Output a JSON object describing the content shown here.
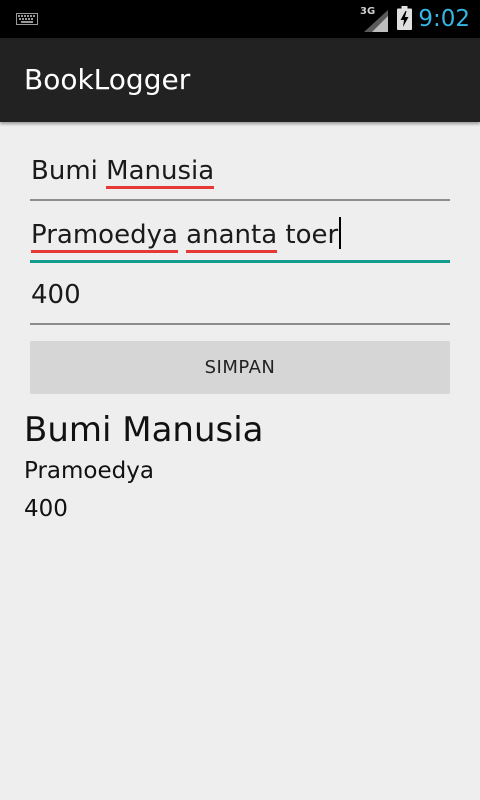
{
  "status_bar": {
    "time": "9:02",
    "network": "3G",
    "icons": [
      "keyboard-icon",
      "signal-icon",
      "battery-charging-icon"
    ]
  },
  "app": {
    "title": "BookLogger"
  },
  "form": {
    "title_value": [
      "Bumi ",
      "Manusia"
    ],
    "author_value": [
      "Pramoedya",
      " ",
      "ananta",
      " toer"
    ],
    "pages_value": "400",
    "save_label": "SIMPAN"
  },
  "result": {
    "title": "Bumi Manusia",
    "author": "Pramoedya",
    "pages": "400"
  },
  "colors": {
    "status_bar_bg": "#000000",
    "clock": "#33b5e5",
    "action_bar_bg": "#222222",
    "background": "#eeeeee",
    "focus_underline": "#129c8d",
    "spellcheck": "#e53935",
    "button_bg": "#d6d6d6"
  }
}
